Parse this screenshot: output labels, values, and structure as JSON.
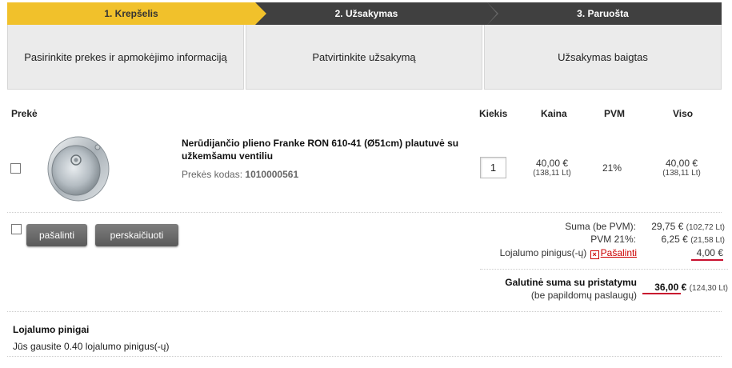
{
  "steps": [
    {
      "label": "1. Krepšelis",
      "description": "Pasirinkite prekes ir apmokėjimo informaciją"
    },
    {
      "label": "2. Užsakymas",
      "description": "Patvirtinkite užsakymą"
    },
    {
      "label": "3. Paruošta",
      "description": "Užsakymas baigtas"
    }
  ],
  "colors": {
    "active_step": "#f1c12b",
    "inactive_step": "#404040",
    "accent_red": "#c8102e"
  },
  "table": {
    "headers": {
      "item": "Prekė",
      "quantity": "Kiekis",
      "price": "Kaina",
      "vat": "PVM",
      "total": "Viso"
    }
  },
  "product": {
    "name": "Nerūdijančio plieno Franke RON 610-41 (Ø51cm) plautuvė su užkemšamu ventiliu",
    "code_label": "Prekės kodas:",
    "code": "1010000561",
    "quantity": "1",
    "price": "40,00 €",
    "price_lt": "(138,11 Lt)",
    "vat": "21%",
    "total": "40,00 €",
    "total_lt": "(138,11 Lt)",
    "image_icon": "sink-image"
  },
  "buttons": {
    "remove": "pašalinti",
    "recalculate": "perskaičiuoti"
  },
  "summary": {
    "sum_label": "Suma (be PVM):",
    "sum_value": "29,75 €",
    "sum_value_lt": "(102,72 Lt)",
    "vat_label": "PVM 21%:",
    "vat_value": "6,25 €",
    "vat_value_lt": "(21,58 Lt)",
    "loyalty_label": "Lojalumo pinigus(-ų)",
    "loyalty_remove": "Pašalinti",
    "loyalty_value": "4,00 €",
    "final_label_1": "Galutinė suma su pristatymu",
    "final_label_2": "(be papildomų paslaugų)",
    "final_value": "36,00 €",
    "final_value_lt": "(124,30 Lt)"
  },
  "loyalty": {
    "title": "Lojalumo pinigai",
    "text": "Jūs gausite 0.40 lojalumo pinigus(-ų)"
  }
}
